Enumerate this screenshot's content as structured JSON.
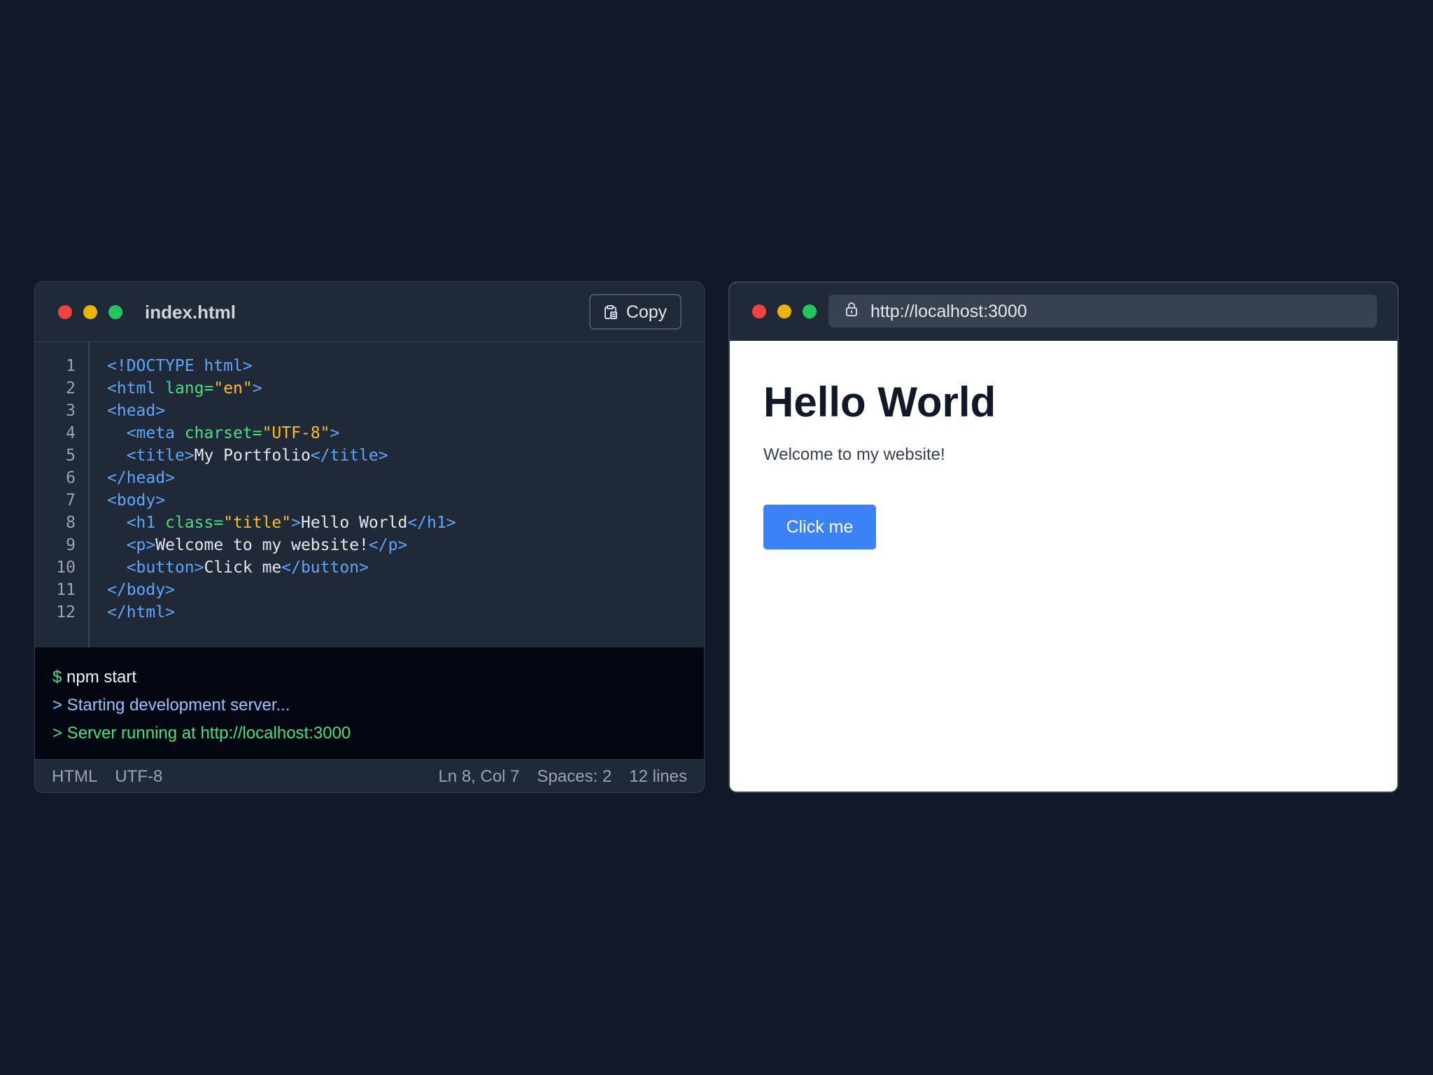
{
  "editor": {
    "filename": "index.html",
    "copy_label": "Copy",
    "code_lines": [
      [
        {
          "t": "tag",
          "v": "<!DOCTYPE html>"
        }
      ],
      [
        {
          "t": "tag",
          "v": "<html "
        },
        {
          "t": "attr",
          "v": "lang="
        },
        {
          "t": "str",
          "v": "\"en\""
        },
        {
          "t": "tag",
          "v": ">"
        }
      ],
      [
        {
          "t": "tag",
          "v": "<head>"
        }
      ],
      [
        {
          "t": "text",
          "v": "  "
        },
        {
          "t": "tag",
          "v": "<meta "
        },
        {
          "t": "attr",
          "v": "charset="
        },
        {
          "t": "str",
          "v": "\"UTF-8\""
        },
        {
          "t": "tag",
          "v": ">"
        }
      ],
      [
        {
          "t": "text",
          "v": "  "
        },
        {
          "t": "tag",
          "v": "<title>"
        },
        {
          "t": "text",
          "v": "My Portfolio"
        },
        {
          "t": "tag",
          "v": "</title>"
        }
      ],
      [
        {
          "t": "tag",
          "v": "</head>"
        }
      ],
      [
        {
          "t": "tag",
          "v": "<body>"
        }
      ],
      [
        {
          "t": "text",
          "v": "  "
        },
        {
          "t": "tag",
          "v": "<h1 "
        },
        {
          "t": "attr",
          "v": "class="
        },
        {
          "t": "str",
          "v": "\"title\""
        },
        {
          "t": "tag",
          "v": ">"
        },
        {
          "t": "text",
          "v": "Hello World"
        },
        {
          "t": "tag",
          "v": "</h1>"
        }
      ],
      [
        {
          "t": "text",
          "v": "  "
        },
        {
          "t": "tag",
          "v": "<p>"
        },
        {
          "t": "text",
          "v": "Welcome to my website!"
        },
        {
          "t": "tag",
          "v": "</p>"
        }
      ],
      [
        {
          "t": "text",
          "v": "  "
        },
        {
          "t": "tag",
          "v": "<button>"
        },
        {
          "t": "text",
          "v": "Click me"
        },
        {
          "t": "tag",
          "v": "</button>"
        }
      ],
      [
        {
          "t": "tag",
          "v": "</body>"
        }
      ],
      [
        {
          "t": "tag",
          "v": "</html>"
        }
      ]
    ],
    "line_numbers": [
      "1",
      "2",
      "3",
      "4",
      "5",
      "6",
      "7",
      "8",
      "9",
      "10",
      "11",
      "12"
    ]
  },
  "terminal": {
    "prompt": "$",
    "command": "npm start",
    "line_info": "> Starting development server...",
    "line_success": "> Server running at http://localhost:3000"
  },
  "statusbar": {
    "language": "HTML",
    "encoding": "UTF-8",
    "cursor": "Ln 8, Col 7",
    "indent": "Spaces: 2",
    "line_count": "12 lines"
  },
  "browser": {
    "url": "http://localhost:3000",
    "page_title": "Hello World",
    "page_text": "Welcome to my website!",
    "button_label": "Click me"
  },
  "icons": {
    "copy": "clipboard-icon",
    "lock": "lock-icon"
  },
  "colors": {
    "background": "#111827",
    "tag": "#60a5fa",
    "attr": "#4ade80",
    "string": "#fbbf24",
    "button": "#3b82f6"
  }
}
